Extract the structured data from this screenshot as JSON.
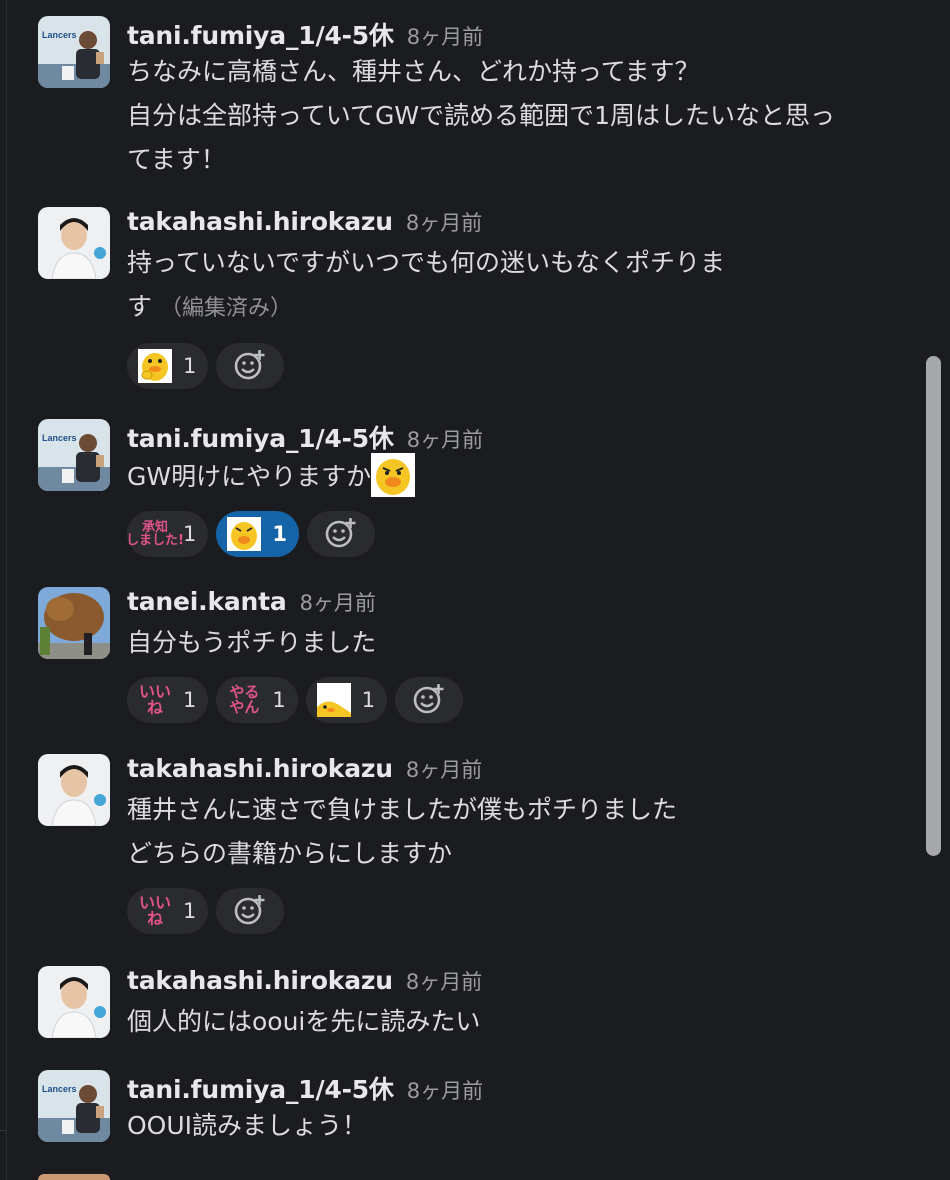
{
  "messages": [
    {
      "author": "tani.fumiya_1/4-5休",
      "time": "8ヶ月前",
      "text": "ちなみに高橋さん、種井さん、どれか持ってます？\n自分は全部持っていてGWで読める範囲で1周はしたいなと思っ\nてます！"
    },
    {
      "author": "takahashi.hirokazu",
      "time": "8ヶ月前",
      "text": "持っていないですがいつでも何の迷いもなくポチりま\nす",
      "edited": "（編集済み）",
      "reactions": [
        {
          "emoji": "duck-hands-emoji",
          "count": "1"
        }
      ]
    },
    {
      "author": "tani.fumiya_1/4-5休",
      "time": "8ヶ月前",
      "text": "GW明けにやりますか",
      "reactions": [
        {
          "emoji": "shouchi-shimashita-emoji",
          "label": "承知\nしました!",
          "count": "1"
        },
        {
          "emoji": "duck-face-emoji",
          "count": "1",
          "active": true
        }
      ]
    },
    {
      "author": "tanei.kanta",
      "time": "8ヶ月前",
      "text": "自分もうポチりました",
      "reactions": [
        {
          "emoji": "iine-emoji",
          "label": "いいね",
          "count": "1"
        },
        {
          "emoji": "yaruyan-emoji",
          "label": "やる\nやん",
          "count": "1"
        },
        {
          "emoji": "duck-peek-emoji",
          "count": "1"
        }
      ]
    },
    {
      "author": "takahashi.hirokazu",
      "time": "8ヶ月前",
      "text": "種井さんに速さで負けましたが僕もポチりました\nどちらの書籍からにしますか",
      "reactions": [
        {
          "emoji": "iine-emoji",
          "label": "いいね",
          "count": "1"
        }
      ]
    },
    {
      "author": "takahashi.hirokazu",
      "time": "8ヶ月前",
      "text": "個人的にはoouiを先に読みたい"
    },
    {
      "author": "tani.fumiya_1/4-5休",
      "time": "8ヶ月前",
      "text": "OOUI読みましょう！"
    }
  ],
  "avatar_labels": {
    "lancers": "Lancers"
  },
  "colors": {
    "background": "#1b1c1f",
    "active_reaction": "#1664a8",
    "reaction_bg": "#2a2b2f",
    "pink_badge": "#e0528a"
  }
}
